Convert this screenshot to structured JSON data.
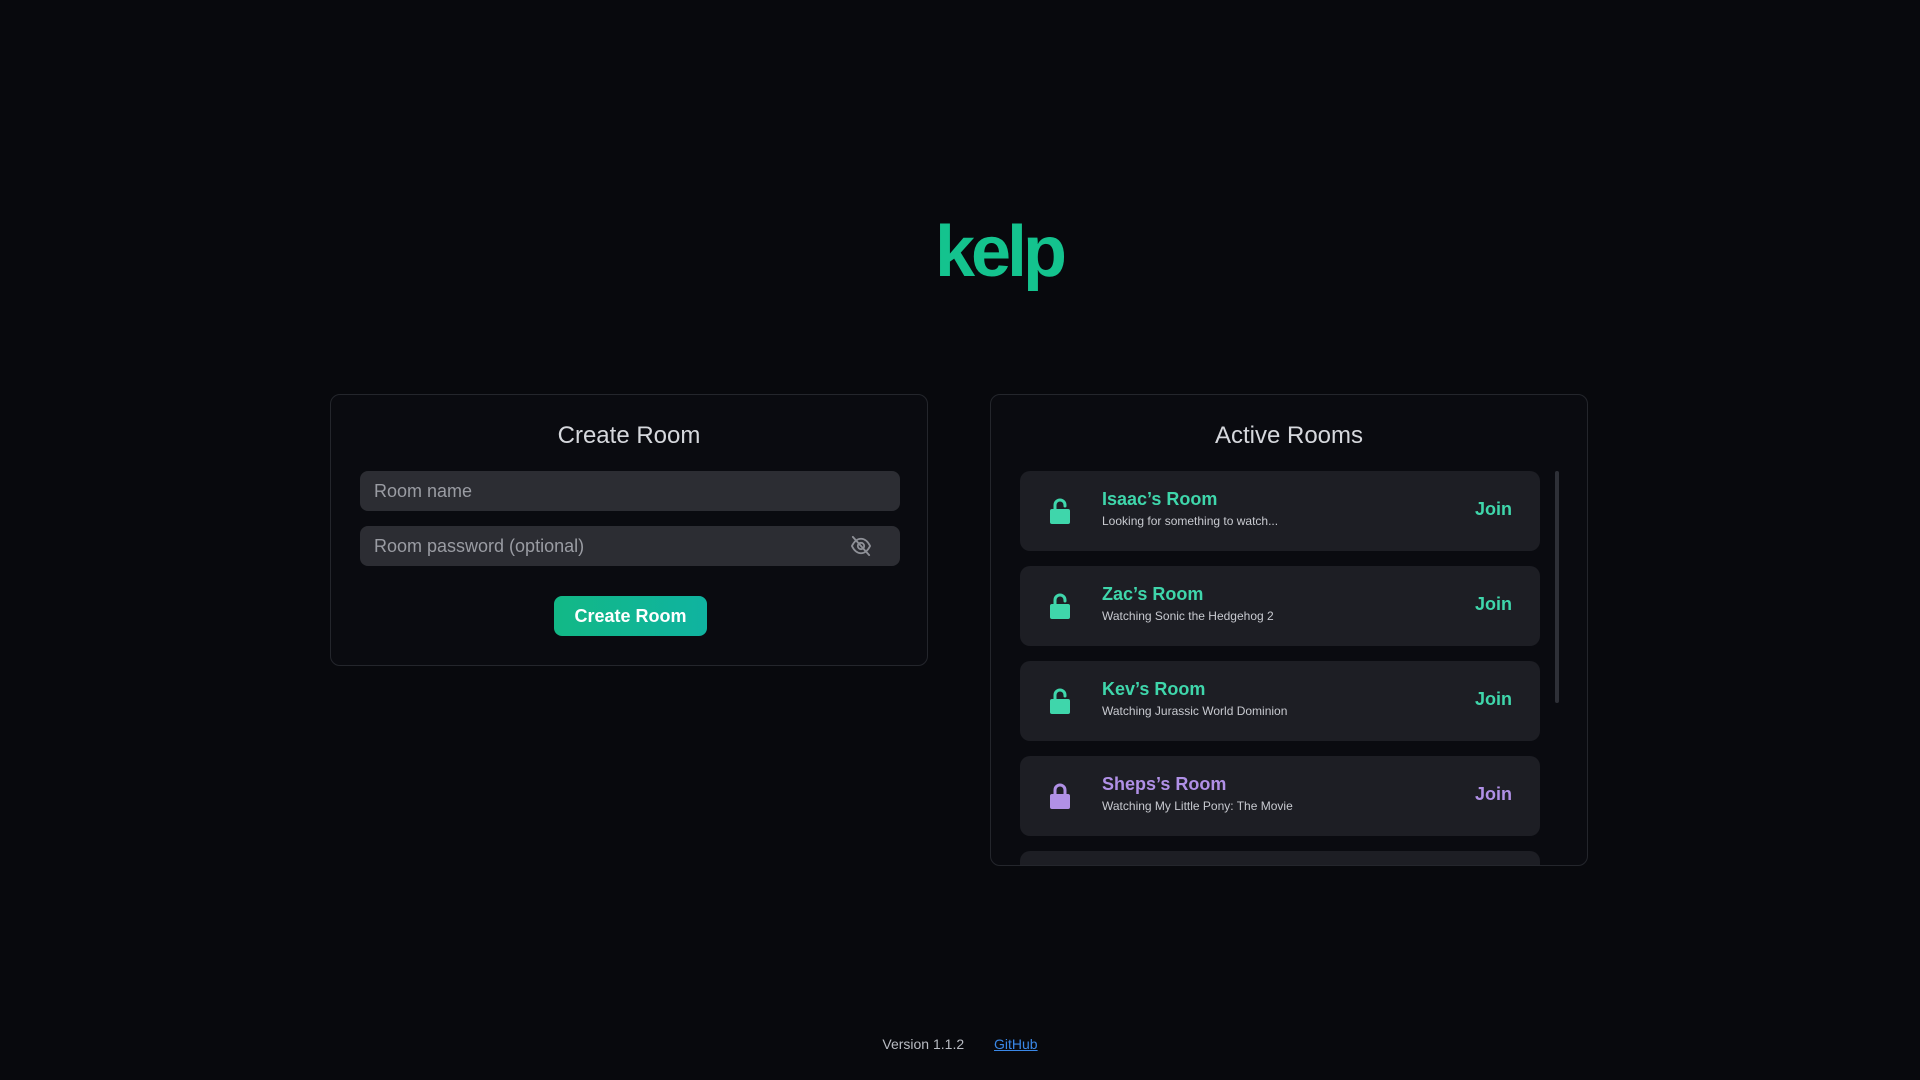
{
  "app": {
    "logo_text": "kelp",
    "brand_color": "#14c38e"
  },
  "create_room": {
    "title": "Create Room",
    "room_name_placeholder": "Room name",
    "room_name_value": "",
    "password_placeholder": "Room password (optional)",
    "password_value": "",
    "password_toggle_icon": "eye-off-icon",
    "submit_label": "Create Room"
  },
  "active_rooms": {
    "title": "Active Rooms",
    "rooms": [
      {
        "name": "Isaac’s Room",
        "description": "Looking for something to watch...",
        "locked": false,
        "lock_icon": "unlocked-padlock-icon",
        "join_label": "Join",
        "accent": "#3fd6ab"
      },
      {
        "name": "Zac’s Room",
        "description": "Watching Sonic the Hedgehog 2",
        "locked": false,
        "lock_icon": "unlocked-padlock-icon",
        "join_label": "Join",
        "accent": "#3fd6ab"
      },
      {
        "name": "Kev’s Room",
        "description": "Watching Jurassic World Dominion",
        "locked": false,
        "lock_icon": "unlocked-padlock-icon",
        "join_label": "Join",
        "accent": "#3fd6ab"
      },
      {
        "name": "Sheps’s Room",
        "description": "Watching My Little Pony: The Movie",
        "locked": true,
        "lock_icon": "locked-padlock-icon",
        "join_label": "Join",
        "accent": "#b090e6"
      }
    ]
  },
  "footer": {
    "version": "Version 1.1.2",
    "github_label": "GitHub"
  }
}
